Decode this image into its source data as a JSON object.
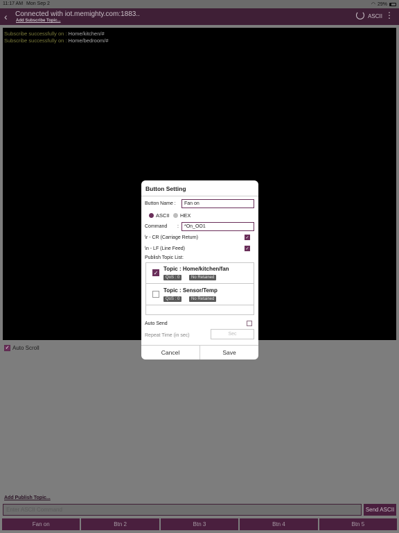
{
  "status_bar": {
    "time": "11:17 AM",
    "date": "Mon Sep 2",
    "battery": "29%"
  },
  "header": {
    "title": "Connected with iot.memighty.com:1883..",
    "subtitle": "Add Subscribe Topic...",
    "mode": "ASCII"
  },
  "console": {
    "lines": [
      {
        "prefix": "Subscribe successfully on : ",
        "topic": "Home/kitchen/#"
      },
      {
        "prefix": "Subscribe successfully on : ",
        "topic": "Home/bedroom/#"
      }
    ]
  },
  "auto_scroll": {
    "label": "Auto Scroll",
    "checked": true
  },
  "dialog": {
    "title": "Button Setting",
    "button_name_label": "Button Name :",
    "button_name_value": "Fan on",
    "format_ascii": "ASCII",
    "format_hex": "HEX",
    "format_selected": "ASCII",
    "command_label": "Command",
    "command_colon": ":",
    "command_value": "*On_OO1",
    "cr_label": "\\r - CR (Carriage Return)",
    "cr_checked": true,
    "lf_label": "\\n - LF (Line Feed)",
    "lf_checked": true,
    "publish_list_label": "Publish Topic List:",
    "topics": [
      {
        "name": "Topic : Home/kitchen/fan",
        "qos": "QoS : 0",
        "retained": "No Retained",
        "checked": true
      },
      {
        "name": "Topic : Sensor/Temp",
        "qos": "QoS : 0",
        "retained": "No Retained",
        "checked": false
      }
    ],
    "auto_send_label": "Auto Send",
    "auto_send_checked": false,
    "repeat_label": "Repeat Time (in sec)",
    "repeat_placeholder": "Sec",
    "cancel": "Cancel",
    "save": "Save"
  },
  "bottom": {
    "add_publish": "Add Publish Topic...",
    "command_placeholder": "Enter ASCII Command",
    "send_label": "Send ASCII",
    "buttons": [
      "Fan on",
      "Btn 2",
      "Btn 3",
      "Btn 4",
      "Btn 5"
    ]
  },
  "colors": {
    "accent": "#6a2f5a",
    "header_bg": "#3f1f36",
    "overlay": "#7d7d7d"
  }
}
